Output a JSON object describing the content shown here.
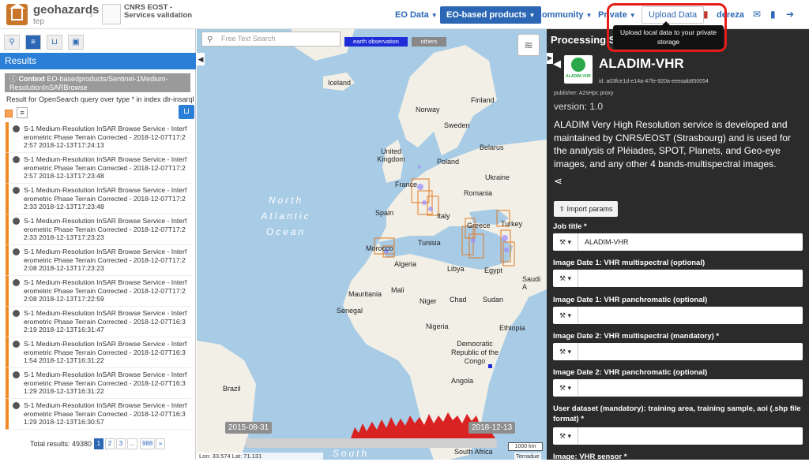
{
  "header": {
    "brand": "geohazards",
    "brand_sub": "tep",
    "crumb_title": "CNRS EOST - Services validation",
    "nav": {
      "eo_data": "EO Data",
      "eo_products": "EO-based products",
      "community": "Community",
      "private": "Private",
      "upload": "Upload Data",
      "user": "dereza"
    },
    "tooltip": "Upload local data to your private storage"
  },
  "left": {
    "results_title": "Results",
    "context_label": "Context",
    "context_value": "EO-basedproducts/Sentinel-1Medium-ResolutionInSARBrowse",
    "query": "Result for OpenSearch query over type * in index dlr-insarql",
    "items": [
      {
        "line1": "S-1 Medium-Resolution InSAR Browse Service - Interf",
        "line2": "erometric Phase Terrain Corrected - 2018-12-07T17:2",
        "line3": "2:57 2018-12-13T17:24:13"
      },
      {
        "line1": "S-1 Medium-Resolution InSAR Browse Service - Interf",
        "line2": "erometric Phase Terrain Corrected - 2018-12-07T17:2",
        "line3": "2:57 2018-12-13T17:23:48"
      },
      {
        "line1": "S-1 Medium-Resolution InSAR Browse Service - Interf",
        "line2": "erometric Phase Terrain Corrected - 2018-12-07T17:2",
        "line3": "2:33 2018-12-13T17:23:48"
      },
      {
        "line1": "S-1 Medium-Resolution InSAR Browse Service - Interf",
        "line2": "erometric Phase Terrain Corrected - 2018-12-07T17:2",
        "line3": "2:33 2018-12-13T17:23:23"
      },
      {
        "line1": "S-1 Medium-Resolution InSAR Browse Service - Interf",
        "line2": "erometric Phase Terrain Corrected - 2018-12-07T17:2",
        "line3": "2:08 2018-12-13T17:23:23"
      },
      {
        "line1": "S-1 Medium-Resolution InSAR Browse Service - Interf",
        "line2": "erometric Phase Terrain Corrected - 2018-12-07T17:2",
        "line3": "2:08 2018-12-13T17:22:59"
      },
      {
        "line1": "S-1 Medium-Resolution InSAR Browse Service - Interf",
        "line2": "erometric Phase Terrain Corrected - 2018-12-07T16:3",
        "line3": "2:19 2018-12-13T16:31:47"
      },
      {
        "line1": "S-1 Medium-Resolution InSAR Browse Service - Interf",
        "line2": "erometric Phase Terrain Corrected - 2018-12-07T16:3",
        "line3": "1:54 2018-12-13T16:31:22"
      },
      {
        "line1": "S-1 Medium-Resolution InSAR Browse Service - Interf",
        "line2": "erometric Phase Terrain Corrected - 2018-12-07T16:3",
        "line3": "1:29 2018-12-13T16:31:22"
      },
      {
        "line1": "S-1 Medium-Resolution InSAR Browse Service - Interf",
        "line2": "erometric Phase Terrain Corrected - 2018-12-07T16:3",
        "line3": "1:29 2018-12-13T16:30:57"
      }
    ],
    "total": "Total results: 49380",
    "pages": [
      "1",
      "2",
      "3",
      "...",
      "988",
      "»"
    ]
  },
  "map": {
    "search_placeholder": "Free Text Search",
    "chip_eo": "earth observation",
    "chip_others": "others",
    "labels": {
      "iceland": "Iceland",
      "norway": "Norway",
      "finland": "Finland",
      "sweden": "Sweden",
      "uk": "United Kingdom",
      "belarus": "Belarus",
      "poland": "Poland",
      "ukraine": "Ukraine",
      "france": "France",
      "romania": "Romania",
      "spain": "Spain",
      "italy": "Italy",
      "greece": "Greece",
      "turkey": "Turkey",
      "tunisia": "Tunisia",
      "morocco": "Morocco",
      "algeria": "Algeria",
      "libya": "Libya",
      "egypt": "Egypt",
      "saudi": "Saudi A",
      "mauritania": "Mauritania",
      "mali": "Mali",
      "niger": "Niger",
      "chad": "Chad",
      "sudan": "Sudan",
      "senegal": "Senegal",
      "nigeria": "Nigeria",
      "ethiopia": "Ethiopia",
      "drc": "Democratic Republic of the Congo",
      "angola": "Angola",
      "brazil": "Brazil",
      "south_africa": "South Africa"
    },
    "ocean_north": "North Atlantic Ocean",
    "ocean_south": "South Atlantic",
    "date_start": "2015-08-31",
    "date_end": "2018-12-13",
    "scale": "1000 km",
    "coords": "Lon: 33.574 Lat: 71.131",
    "attribution": "Terradue"
  },
  "panel": {
    "title": "Processing Services",
    "service_name": "ALADIM-VHR",
    "icon_text": "ALADIM-VHR",
    "id": "id: a03fce1d-e14a-47fe-920a-eeeaab850054",
    "publisher": "publisher: A2sHpc proxy",
    "version": "version: 1.0",
    "description": "ALADIM Very High Resolution service is developed and maintained by CNRS/EOST (Strasbourg) and is used for the analysis of Pléiades, SPOT, Planets, and Geo-eye images, and any other 4 bands-multispectral images.",
    "import_btn": "Import params",
    "fields": [
      {
        "label": "Job title *",
        "value": "ALADIM-VHR"
      },
      {
        "label": "Image Date 1: VHR multispectral (optional)",
        "value": ""
      },
      {
        "label": "Image Date 1: VHR panchromatic (optional)",
        "value": ""
      },
      {
        "label": "Image Date 2: VHR multispectral (mandatory) *",
        "value": ""
      },
      {
        "label": "Image Date 2: VHR panchromatic (optional)",
        "value": ""
      },
      {
        "label": "User dataset (mandatory): training area, training sample, aoi (.shp file format) *",
        "value": ""
      },
      {
        "label": "Image: VHR sensor *",
        "value": ""
      }
    ]
  },
  "colors": {
    "accent": "#2b67b4",
    "results_bar": "#2b7fd6",
    "result_border": "#f08a24",
    "highlight": "#e41b17"
  }
}
